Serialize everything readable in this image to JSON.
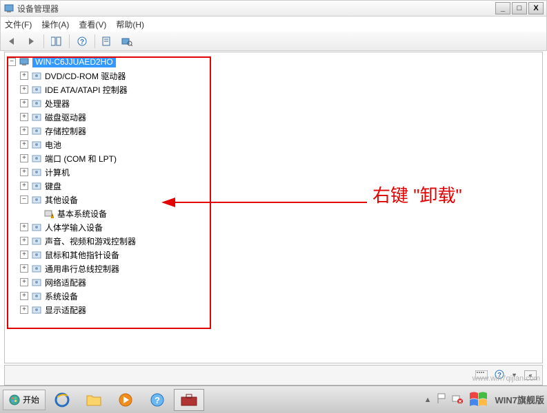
{
  "title": "设备管理器",
  "menus": {
    "file": "文件(F)",
    "action": "操作(A)",
    "view": "查看(V)",
    "help": "帮助(H)"
  },
  "win_buttons": {
    "minimize": "_",
    "maximize": "□",
    "close": "X"
  },
  "toolbar": {
    "back": "back-icon",
    "forward": "forward-icon",
    "show_hide": "views-icon",
    "help": "help-icon",
    "props": "properties-icon",
    "scan": "scan-icon"
  },
  "tree": {
    "root": "WIN-C6JJUAED2HO",
    "nodes": [
      {
        "label": "DVD/CD-ROM 驱动器",
        "icon": "disc-icon",
        "expanded": false
      },
      {
        "label": "IDE ATA/ATAPI 控制器",
        "icon": "ide-icon",
        "expanded": false
      },
      {
        "label": "处理器",
        "icon": "cpu-icon",
        "expanded": false
      },
      {
        "label": "磁盘驱动器",
        "icon": "disk-icon",
        "expanded": false
      },
      {
        "label": "存储控制器",
        "icon": "storage-icon",
        "expanded": false
      },
      {
        "label": "电池",
        "icon": "battery-icon",
        "expanded": false
      },
      {
        "label": "端口 (COM 和 LPT)",
        "icon": "port-icon",
        "expanded": false
      },
      {
        "label": "计算机",
        "icon": "computer-icon",
        "expanded": false
      },
      {
        "label": "键盘",
        "icon": "keyboard-icon",
        "expanded": false
      },
      {
        "label": "其他设备",
        "icon": "other-icon",
        "expanded": true,
        "children": [
          {
            "label": "基本系统设备",
            "icon": "warning-device-icon"
          }
        ]
      },
      {
        "label": "人体学输入设备",
        "icon": "hid-icon",
        "expanded": false
      },
      {
        "label": "声音、视频和游戏控制器",
        "icon": "sound-icon",
        "expanded": false
      },
      {
        "label": "鼠标和其他指针设备",
        "icon": "mouse-icon",
        "expanded": false
      },
      {
        "label": "通用串行总线控制器",
        "icon": "usb-icon",
        "expanded": false
      },
      {
        "label": "网络适配器",
        "icon": "network-icon",
        "expanded": false
      },
      {
        "label": "系统设备",
        "icon": "system-icon",
        "expanded": false
      },
      {
        "label": "显示适配器",
        "icon": "display-icon",
        "expanded": false
      }
    ]
  },
  "annotation": "右键 \"卸载\"",
  "taskbar": {
    "start": "开始",
    "brand": "WIN7旗舰版"
  },
  "watermark": "www.win7qijian.com"
}
